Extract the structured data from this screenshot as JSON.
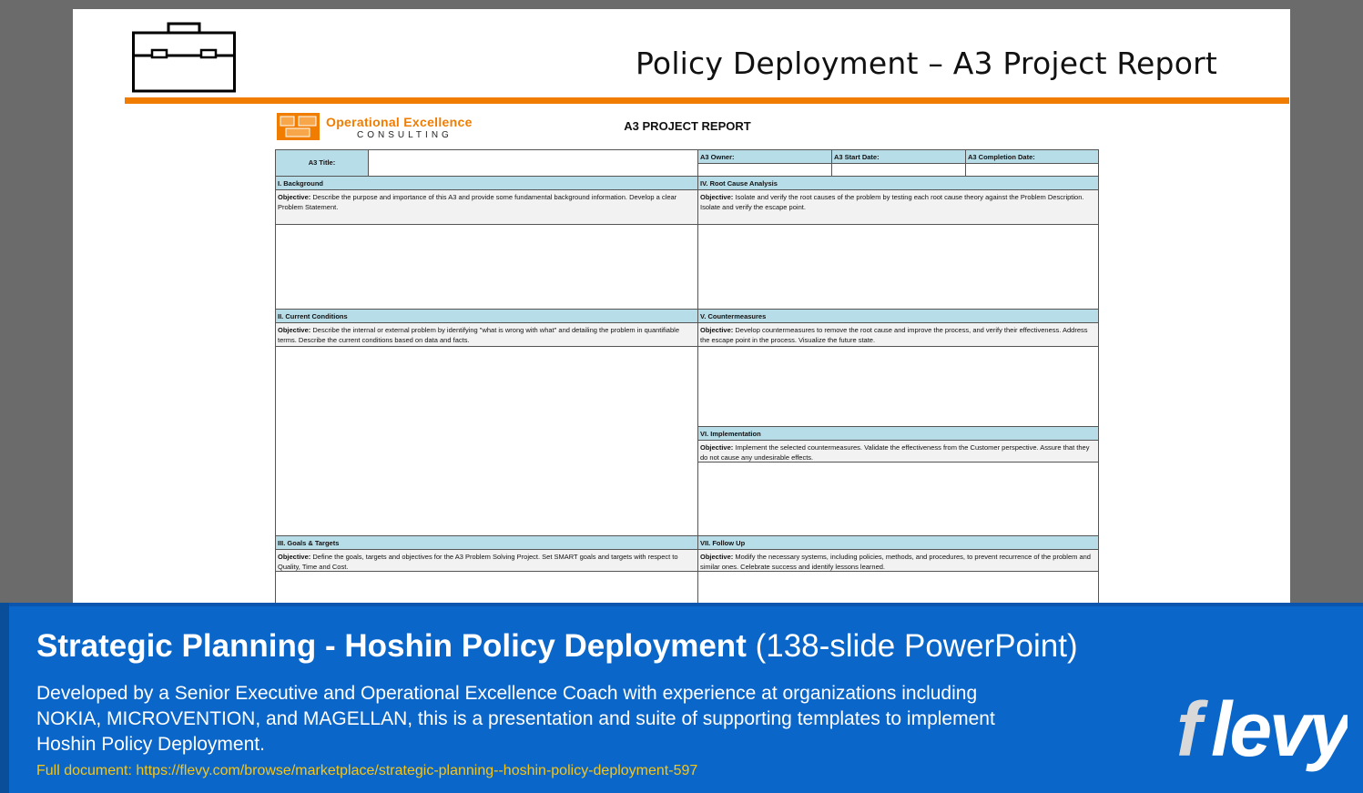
{
  "slide": {
    "title": "Policy Deployment – A3 Project Report",
    "icon": "briefcase-icon",
    "accent_color": "#f07d00"
  },
  "logo": {
    "line1": "Operational Excellence",
    "line2": "CONSULTING",
    "color": "#f07d00"
  },
  "report": {
    "heading": "A3 PROJECT REPORT",
    "header_fill": "#b7dde8",
    "a3_title_label": "A3 Title:",
    "a3_owner_label": "A3 Owner:",
    "a3_start_label": "A3 Start Date:",
    "a3_completion_label": "A3 Completion Date:",
    "objective_label": "Objective:",
    "sections": {
      "background": {
        "title": "I. Background",
        "objective": "Describe the purpose and importance of this A3 and provide some fundamental background information. Develop a clear Problem Statement."
      },
      "current": {
        "title": "II. Current Conditions",
        "objective": "Describe the internal or external problem by identifying \"what is wrong with what\" and detailing the problem in quantifiable terms. Describe the current conditions based on data and facts."
      },
      "goals": {
        "title": "III. Goals & Targets",
        "objective": "Define the goals, targets and objectives for the A3 Problem Solving Project. Set SMART goals and targets with respect to Quality, Time and Cost."
      },
      "root": {
        "title": "IV. Root Cause Analysis",
        "objective": "Isolate and verify the root causes of the problem by testing each root cause theory against the Problem Description. Isolate and verify the escape point."
      },
      "counter": {
        "title": "V. Countermeasures",
        "objective": "Develop countermeasures to remove the root cause and improve the process, and verify their effectiveness. Address the escape point in the process. Visualize the future state."
      },
      "impl": {
        "title": "VI. Implementation",
        "objective": "Implement the selected countermeasures. Validate the effectiveness from the Customer perspective. Assure that they do not cause any undesirable effects."
      },
      "follow": {
        "title": "VII. Follow Up",
        "objective": "Modify the necessary systems, including policies, methods, and procedures, to prevent recurrence of the problem and similar ones. Celebrate success and identify lessons learned."
      }
    }
  },
  "banner": {
    "title_bold": "Strategic Planning - Hoshin Policy Deployment",
    "title_light": "(138-slide PowerPoint)",
    "description": "Developed by a Senior Executive and Operational Excellence Coach with experience at organizations including NOKIA, MICROVENTION, and MAGELLAN, this is a presentation and suite of supporting templates to implement Hoshin Policy Deployment.",
    "link": "Full document: https://flevy.com/browse/marketplace/strategic-planning--hoshin-policy-deployment-597",
    "brand": "flevy",
    "background_color": "#0b66c9",
    "link_color": "#f5c518"
  }
}
